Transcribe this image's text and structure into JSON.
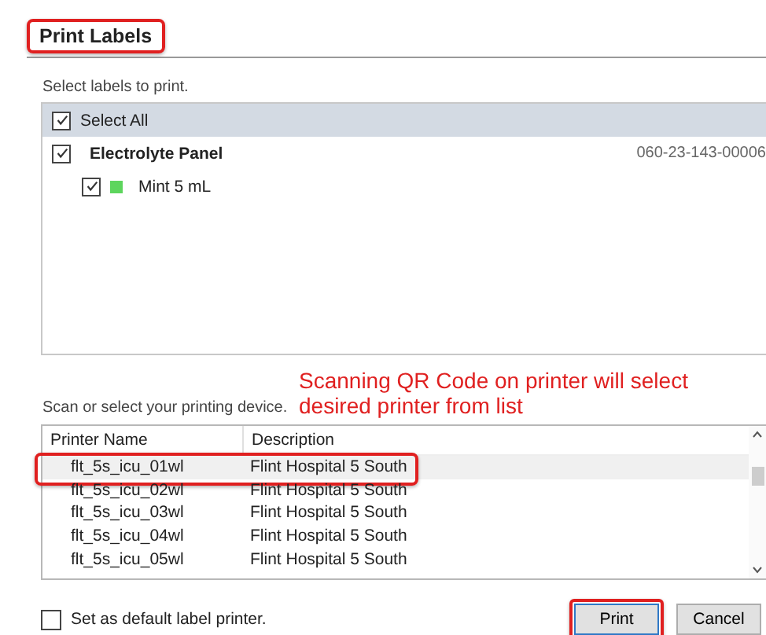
{
  "dialog": {
    "title": "Print Labels",
    "title_highlighted": true
  },
  "labels": {
    "instruction": "Select labels to print.",
    "items": [
      {
        "kind": "select-all",
        "text": "Select All",
        "checked": true,
        "selected": true
      },
      {
        "kind": "order",
        "text": "Electrolyte Panel",
        "number": "060-23-143-00006",
        "checked": true,
        "selected": false
      },
      {
        "kind": "tube",
        "text": "Mint 5 mL",
        "color": "#5dd55d",
        "checked": true,
        "selected": false
      }
    ]
  },
  "printers": {
    "instruction": "Scan or select your printing device.",
    "annotation": "Scanning QR Code on printer will select desired printer from list",
    "columns": [
      "Printer Name",
      "Description"
    ],
    "rows": [
      {
        "name": "flt_5s_icu_01wl",
        "description": "Flint Hospital 5 South",
        "selected": true,
        "highlighted": true
      },
      {
        "name": "flt_5s_icu_02wl",
        "description": "Flint Hospital 5 South",
        "selected": false,
        "highlighted": false
      },
      {
        "name": "flt_5s_icu_03wl",
        "description": "Flint Hospital 5 South",
        "selected": false,
        "highlighted": false
      },
      {
        "name": "flt_5s_icu_04wl",
        "description": "Flint Hospital 5 South",
        "selected": false,
        "highlighted": false
      },
      {
        "name": "flt_5s_icu_05wl",
        "description": "Flint Hospital 5 South",
        "selected": false,
        "highlighted": false
      }
    ]
  },
  "footer": {
    "default_printer": {
      "text": "Set as default label printer.",
      "checked": false
    },
    "buttons": [
      {
        "text": "Print",
        "highlighted": true
      },
      {
        "text": "Cancel",
        "highlighted": false
      }
    ]
  }
}
